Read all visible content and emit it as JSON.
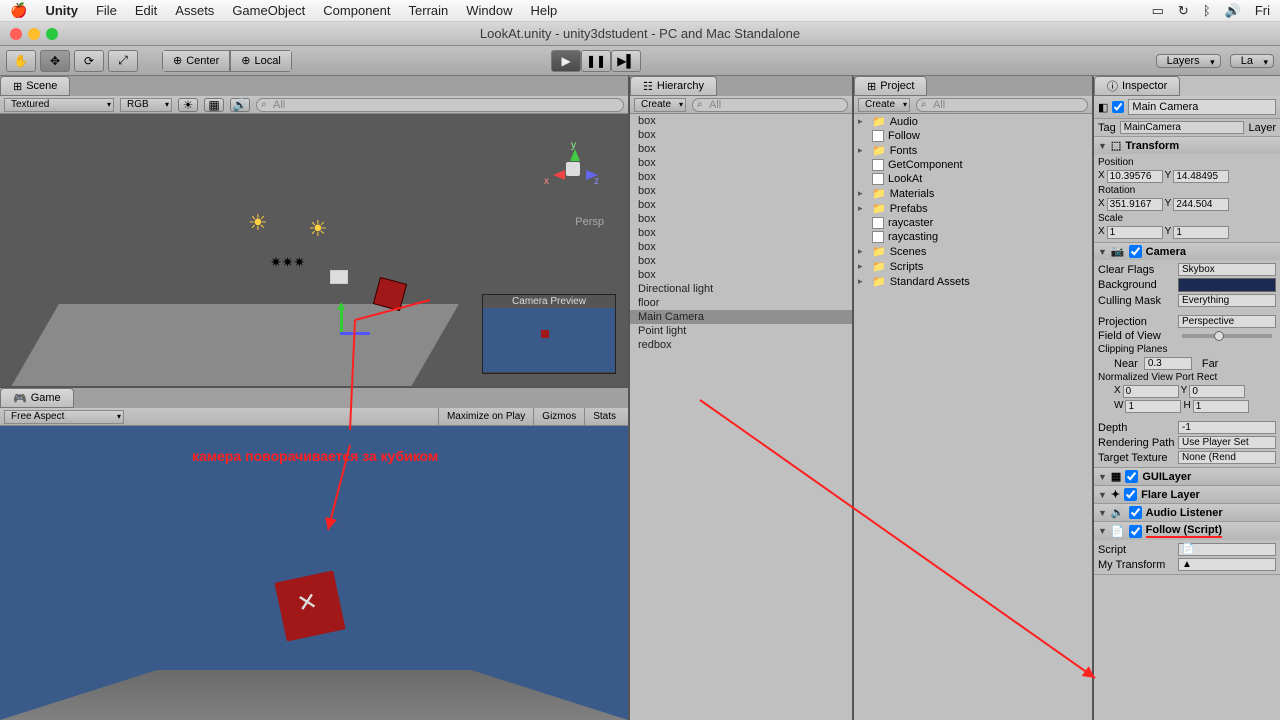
{
  "mac_menu": {
    "app": "Unity",
    "items": [
      "File",
      "Edit",
      "Assets",
      "GameObject",
      "Component",
      "Terrain",
      "Window",
      "Help"
    ],
    "clock": "Fri"
  },
  "window_title": "LookAt.unity - unity3dstudent - PC and Mac Standalone",
  "toolbar": {
    "pivot": "Center",
    "handle": "Local",
    "layers": "Layers",
    "layout": "La"
  },
  "scene_panel": {
    "tab": "Scene",
    "shading": "Textured",
    "render": "RGB",
    "search_placeholder": "All",
    "preview_title": "Camera Preview",
    "persp": "Persp",
    "axis": {
      "x": "x",
      "y": "y",
      "z": "z"
    }
  },
  "game_panel": {
    "tab": "Game",
    "aspect": "Free Aspect",
    "buttons": [
      "Maximize on Play",
      "Gizmos",
      "Stats"
    ],
    "annotation": "камера поворачивается за кубиком"
  },
  "hierarchy": {
    "tab": "Hierarchy",
    "create": "Create",
    "search_placeholder": "All",
    "items": [
      "box",
      "box",
      "box",
      "box",
      "box",
      "box",
      "box",
      "box",
      "box",
      "box",
      "box",
      "box",
      "Directional light",
      "floor",
      "Main Camera",
      "Point light",
      "redbox"
    ],
    "selected": "Main Camera"
  },
  "project": {
    "tab": "Project",
    "create": "Create",
    "search_placeholder": "All",
    "items": [
      {
        "name": "Audio",
        "type": "folder",
        "expandable": true
      },
      {
        "name": "Follow",
        "type": "script",
        "expandable": false
      },
      {
        "name": "Fonts",
        "type": "folder",
        "expandable": true
      },
      {
        "name": "GetComponent",
        "type": "script",
        "expandable": false
      },
      {
        "name": "LookAt",
        "type": "script",
        "expandable": false
      },
      {
        "name": "Materials",
        "type": "folder",
        "expandable": true
      },
      {
        "name": "Prefabs",
        "type": "folder",
        "expandable": true
      },
      {
        "name": "raycaster",
        "type": "script",
        "expandable": false
      },
      {
        "name": "raycasting",
        "type": "script",
        "expandable": false
      },
      {
        "name": "Scenes",
        "type": "folder",
        "expandable": true
      },
      {
        "name": "Scripts",
        "type": "folder",
        "expandable": true
      },
      {
        "name": "Standard Assets",
        "type": "folder",
        "expandable": true
      }
    ]
  },
  "inspector": {
    "tab": "Inspector",
    "object_name": "Main Camera",
    "tag_label": "Tag",
    "tag_value": "MainCamera",
    "layer_label": "Layer",
    "transform": {
      "title": "Transform",
      "position_label": "Position",
      "rotation_label": "Rotation",
      "scale_label": "Scale",
      "position": {
        "x": "10.39576",
        "y": "14.48495"
      },
      "rotation": {
        "x": "351.9167",
        "y": "244.504"
      },
      "scale": {
        "x": "1",
        "y": "1"
      }
    },
    "camera": {
      "title": "Camera",
      "clear_flags_label": "Clear Flags",
      "clear_flags": "Skybox",
      "background_label": "Background",
      "culling_label": "Culling Mask",
      "culling": "Everything",
      "projection_label": "Projection",
      "projection": "Perspective",
      "fov_label": "Field of View",
      "clip_label": "Clipping Planes",
      "near_label": "Near",
      "near": "0.3",
      "far_label": "Far",
      "viewport_label": "Normalized View Port Rect",
      "vx": "0",
      "vy": "0",
      "vw": "1",
      "vh": "1",
      "depth_label": "Depth",
      "depth": "-1",
      "render_path_label": "Rendering Path",
      "render_path": "Use Player Set",
      "target_label": "Target Texture",
      "target": "None (Rend"
    },
    "components": {
      "guilayer": "GUILayer",
      "flare": "Flare Layer",
      "audio": "Audio Listener",
      "follow": "Follow (Script)",
      "script_label": "Script",
      "mytransform_label": "My Transform"
    }
  }
}
